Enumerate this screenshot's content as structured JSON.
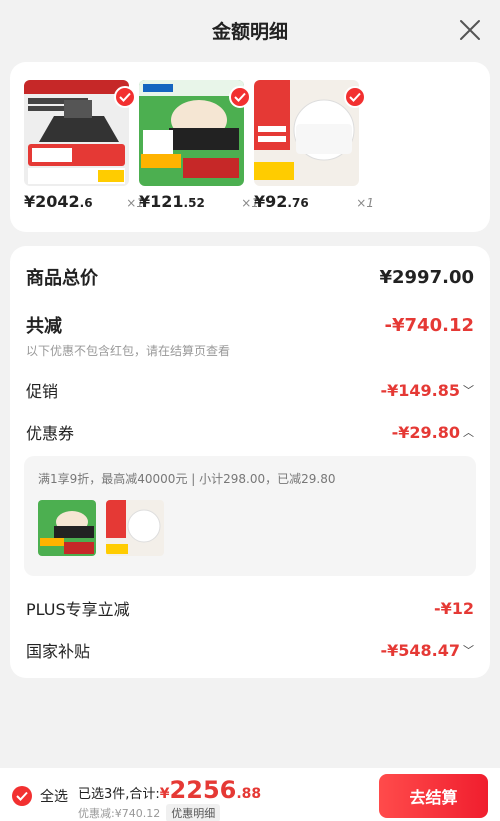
{
  "header": {
    "title": "金额明细"
  },
  "products": [
    {
      "price_int": "¥2042",
      "price_dec": ".6",
      "qty": "×1"
    },
    {
      "price_int": "¥121",
      "price_dec": ".52",
      "qty": "×1"
    },
    {
      "price_int": "¥92",
      "price_dec": ".76",
      "qty": "×1"
    }
  ],
  "summary": {
    "goods_total_label": "商品总价",
    "goods_total_value": "¥2997.00",
    "total_discount_label": "共减",
    "total_discount_value": "-¥740.12",
    "note": "以下优惠不包含红包，请在结算页查看",
    "promo_label": "促销",
    "promo_value": "-¥149.85",
    "coupon_label": "优惠券",
    "coupon_value": "-¥29.80",
    "coupon_desc": "满1享9折，最高减40000元 | 小计298.00，已减29.80",
    "plus_label": "PLUS专享立减",
    "plus_value": "-¥12",
    "subsidy_label": "国家补贴",
    "subsidy_value": "-¥548.47"
  },
  "bottom": {
    "select_all": "全选",
    "total_label": "已选3件,合计:",
    "total_yen": "¥",
    "total_int": "2256",
    "total_dec": ".88",
    "discount": "优惠减:¥740.12",
    "detail": "优惠明细",
    "checkout": "去结算"
  },
  "colors": {
    "accent": "#e53935",
    "button": "#f23030"
  }
}
